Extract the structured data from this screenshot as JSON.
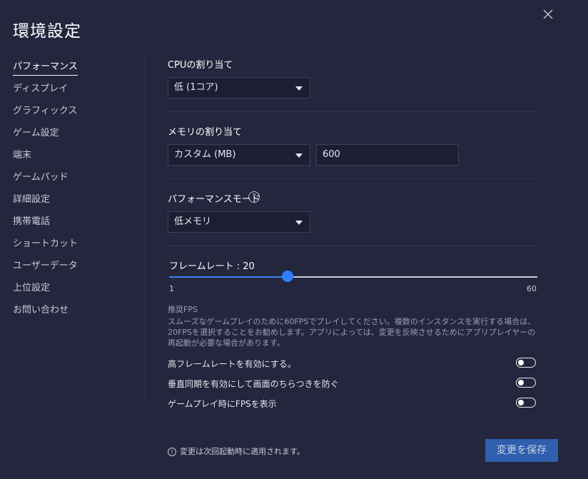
{
  "window": {
    "title": "環境設定"
  },
  "sidebar": {
    "items": [
      {
        "label": "パフォーマンス",
        "active": true
      },
      {
        "label": "ディスプレイ"
      },
      {
        "label": "グラフィックス"
      },
      {
        "label": "ゲーム設定"
      },
      {
        "label": "端末"
      },
      {
        "label": "ゲームパッド"
      },
      {
        "label": "詳細設定"
      },
      {
        "label": "携帯電話"
      },
      {
        "label": "ショートカット"
      },
      {
        "label": "ユーザーデータ"
      },
      {
        "label": "上位設定"
      },
      {
        "label": "お問い合わせ"
      }
    ]
  },
  "performance": {
    "cpu": {
      "label": "CPUの割り当て",
      "value": "低 (1コア)"
    },
    "memory": {
      "label": "メモリの割り当て",
      "value": "カスタム (MB)",
      "custom_value": "600"
    },
    "mode": {
      "label": "パフォーマンスモード",
      "help_icon": "?",
      "value": "低メモリ"
    },
    "frame_rate": {
      "label": "フレームレート : 20",
      "value": 20,
      "min": 1,
      "max": 60,
      "min_label": "1",
      "max_label": "60"
    },
    "recommended": {
      "title": "推奨FPS",
      "body": "スムーズなゲームプレイのために60FPSでプレイしてください。複数のインスタンスを実行する場合は、20FPSを選択することをお勧めします。アプリによっては、変更を反映させるためにアプリプレイヤーの再起動が必要な場合があります。"
    },
    "toggles": [
      {
        "label": "高フレームレートを有効にする。",
        "on": false
      },
      {
        "label": "垂直同期を有効にして画面のちらつきを防ぐ",
        "on": false
      },
      {
        "label": "ゲームプレイ時にFPSを表示",
        "on": false
      }
    ]
  },
  "footer": {
    "info_icon": "i",
    "note": "変更は次回起動時に適用されます。",
    "save_label": "変更を保存"
  },
  "colors": {
    "accent": "#2f80ff",
    "save_button": "#2f5fae",
    "background": "#23263d"
  }
}
